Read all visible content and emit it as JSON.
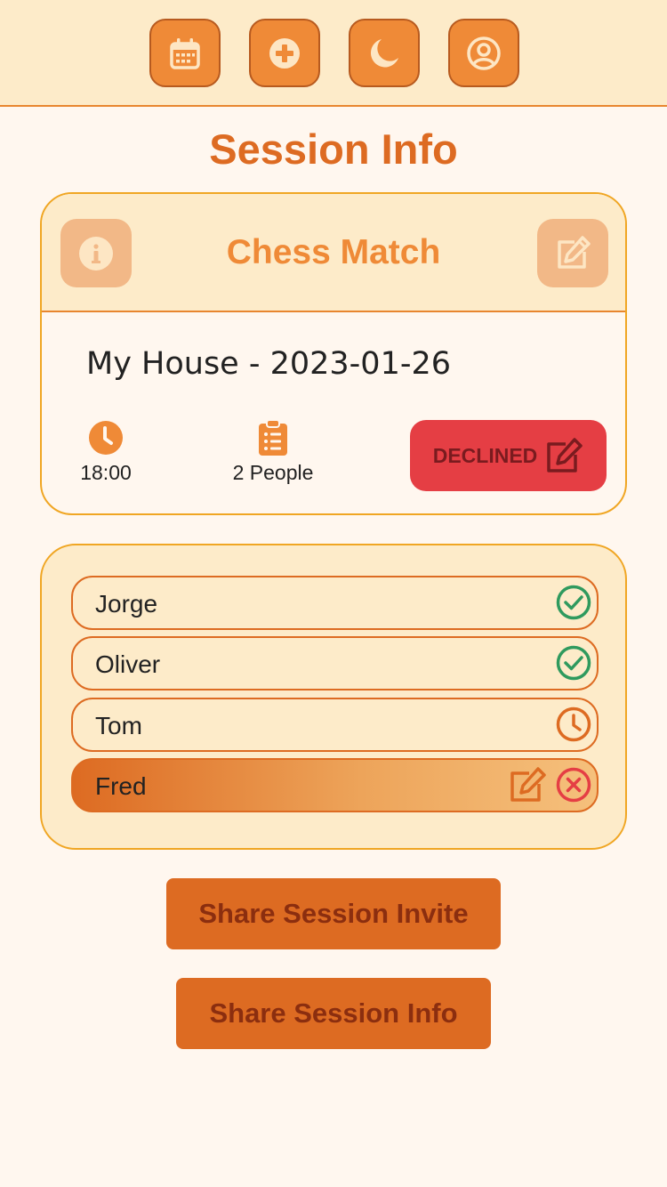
{
  "header": {
    "nav": [
      {
        "icon": "calendar-icon"
      },
      {
        "icon": "plus-circle-icon"
      },
      {
        "icon": "moon-icon"
      },
      {
        "icon": "user-circle-icon"
      }
    ]
  },
  "page": {
    "title": "Session Info"
  },
  "session": {
    "title": "Chess Match",
    "location_date": "My House - 2023-01-26",
    "time": "18:00",
    "people_count": "2 People",
    "status": "DECLINED"
  },
  "participants": [
    {
      "name": "Jorge",
      "status": "accepted"
    },
    {
      "name": "Oliver",
      "status": "accepted"
    },
    {
      "name": "Tom",
      "status": "pending"
    },
    {
      "name": "Fred",
      "status": "declined"
    }
  ],
  "actions": {
    "share_invite": "Share Session Invite",
    "share_info": "Share Session Info"
  },
  "colors": {
    "accent": "#ef8a37",
    "accent_dark": "#dd6b22",
    "header_bg": "#fdebc9",
    "page_bg": "#fff7ef",
    "declined": "#e53e44",
    "accepted": "#2f9a5e"
  }
}
